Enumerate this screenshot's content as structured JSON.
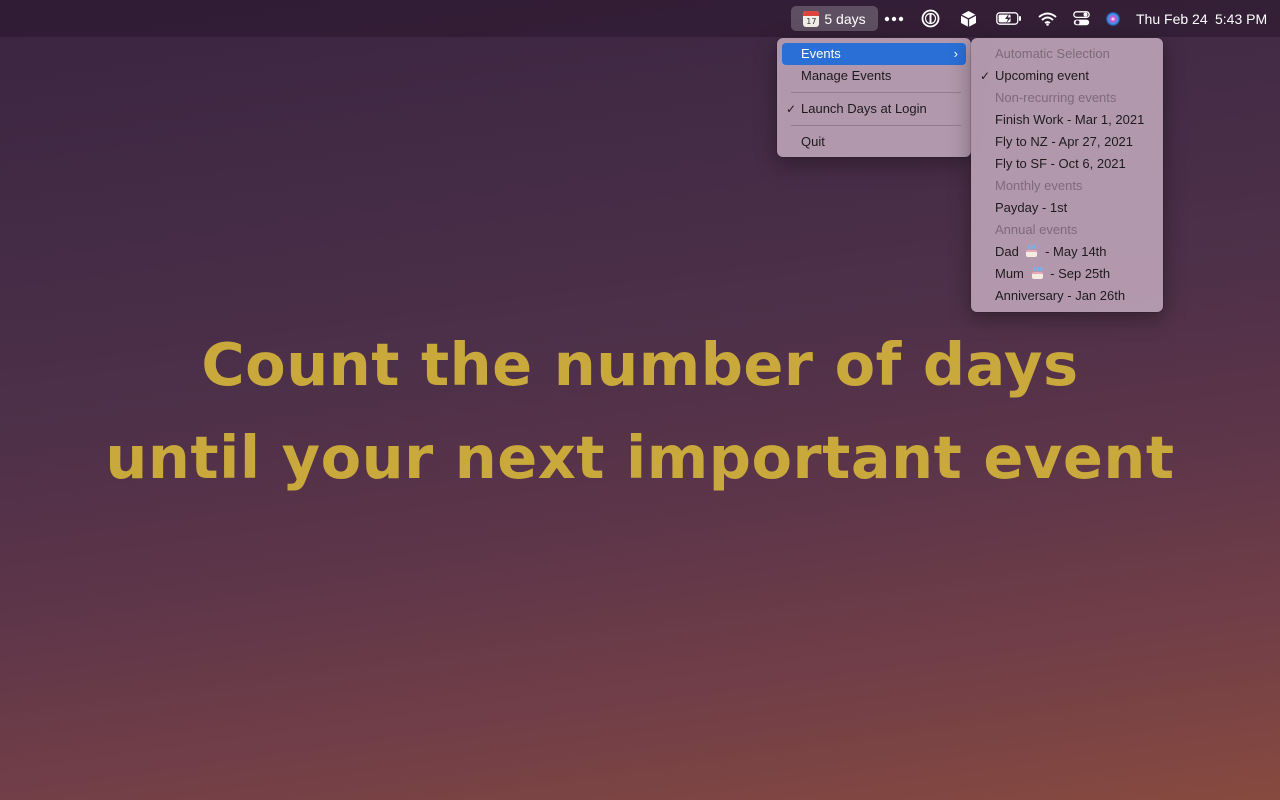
{
  "menubar": {
    "days_label": "5 days",
    "calendar_day": "17",
    "date": "Thu Feb 24",
    "time": "5:43 PM",
    "icons": [
      "calendar-icon",
      "more-icon",
      "onepassword-icon",
      "box-icon",
      "battery-icon",
      "wifi-icon",
      "control-center-icon",
      "siri-icon"
    ]
  },
  "headline": {
    "line1": "Count the number of days",
    "line2": "until your next important event",
    "color": "#c9a83c"
  },
  "main_menu": {
    "events": "Events",
    "manage": "Manage Events",
    "launch": "Launch Days at Login",
    "quit": "Quit",
    "checkmark": "✓",
    "chevron": "›"
  },
  "sub_menu": {
    "auto_header": "Automatic Selection",
    "upcoming": "Upcoming event",
    "nonrecurring_header": "Non-recurring events",
    "finish_work": "Finish Work - Mar 1, 2021",
    "fly_nz": "Fly to NZ - Apr 27, 2021",
    "fly_sf": "Fly to SF - Oct 6, 2021",
    "monthly_header": "Monthly events",
    "payday": "Payday - 1st",
    "annual_header": "Annual events",
    "dad_name": "Dad",
    "dad_date": "- May 14th",
    "mum_name": "Mum",
    "mum_date": "- Sep 25th",
    "anniversary": "Anniversary - Jan 26th",
    "checkmark": "✓"
  },
  "colors": {
    "selection": "#2a6fd6",
    "accent_text": "#c9a83c"
  }
}
